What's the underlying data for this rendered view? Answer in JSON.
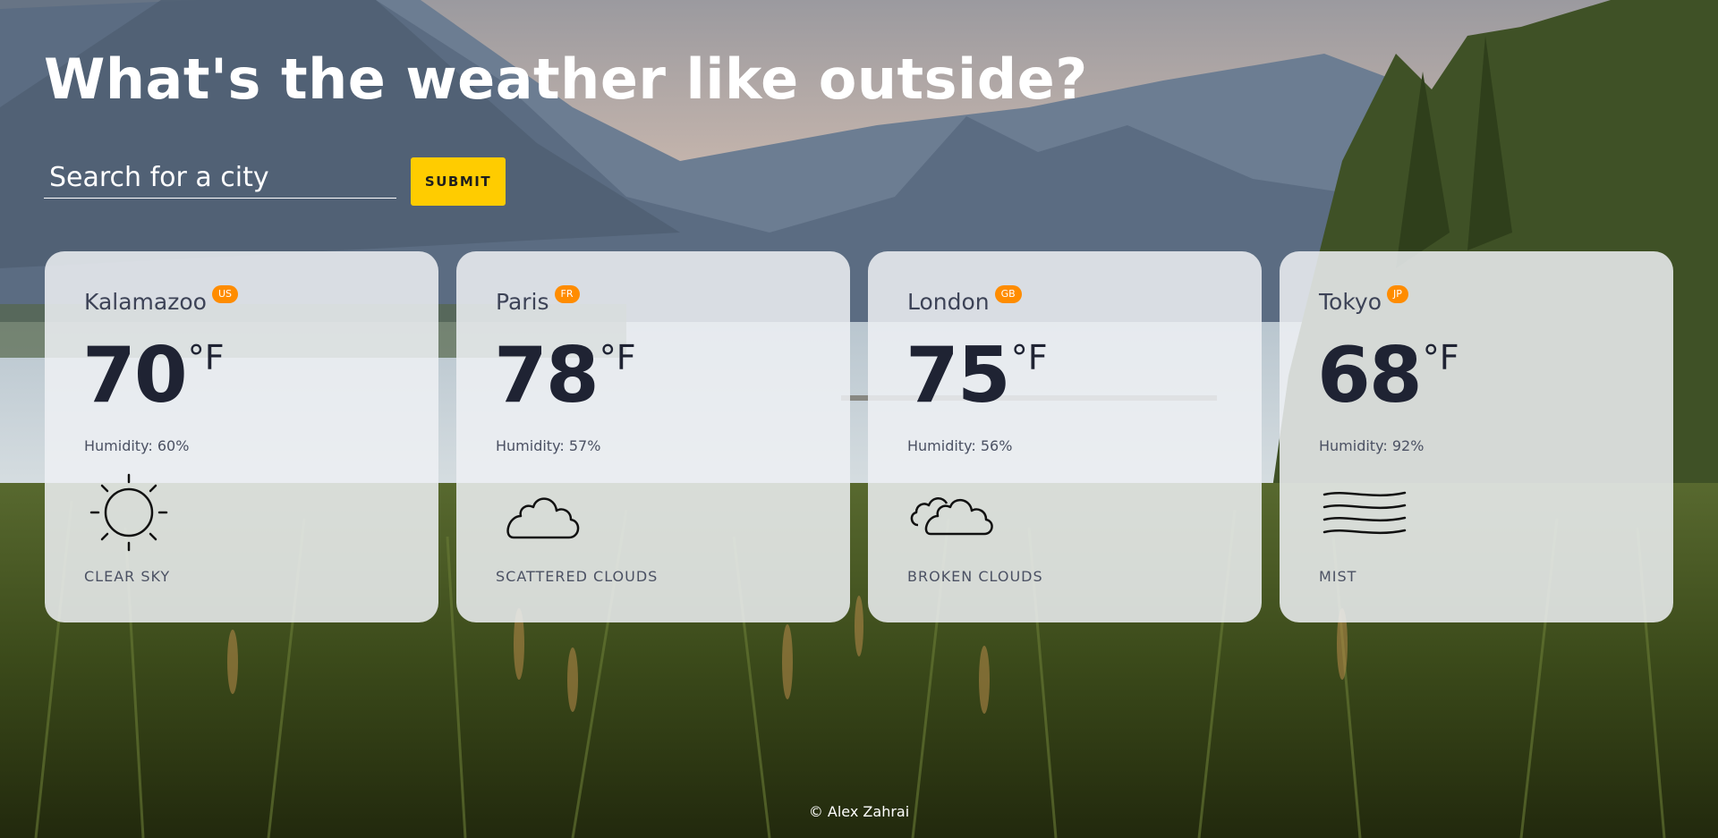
{
  "header": {
    "title": "What's the weather like outside?"
  },
  "search": {
    "placeholder": "Search for a city",
    "value": "",
    "submit_label": "SUBMIT"
  },
  "cards": [
    {
      "city": "Kalamazoo",
      "country": "US",
      "temp": "70",
      "unit": "°F",
      "humidity": "Humidity: 60%",
      "icon": "sun-icon",
      "description": "CLEAR SKY"
    },
    {
      "city": "Paris",
      "country": "FR",
      "temp": "78",
      "unit": "°F",
      "humidity": "Humidity: 57%",
      "icon": "cloud-icon",
      "description": "SCATTERED CLOUDS"
    },
    {
      "city": "London",
      "country": "GB",
      "temp": "75",
      "unit": "°F",
      "humidity": "Humidity: 56%",
      "icon": "clouds-icon",
      "description": "BROKEN CLOUDS"
    },
    {
      "city": "Tokyo",
      "country": "JP",
      "temp": "68",
      "unit": "°F",
      "humidity": "Humidity: 92%",
      "icon": "mist-icon",
      "description": "MIST"
    }
  ],
  "footer": {
    "text": "© Alex Zahrai"
  },
  "colors": {
    "accent": "#ffcc00",
    "badge": "#ff8c00",
    "card_bg": "#eef0f3",
    "temp_text": "#1f2333"
  }
}
